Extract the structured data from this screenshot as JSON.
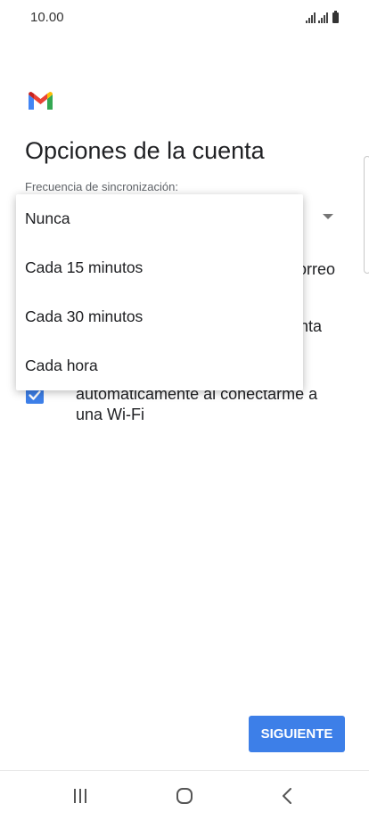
{
  "status_bar": {
    "time": "10.00"
  },
  "page": {
    "title": "Opciones de la cuenta",
    "sync_label": "Frecuencia de sincronización:",
    "background_fragments": [
      "orreo",
      "nta"
    ],
    "wifi_checkbox": {
      "checked": true,
      "label_lines": [
        "automáticamente al conectarme a",
        "una Wi-Fi"
      ]
    }
  },
  "dropdown": {
    "options": [
      "Nunca",
      "Cada 15 minutos",
      "Cada 30 minutos",
      "Cada hora"
    ]
  },
  "actions": {
    "next_label": "SIGUIENTE"
  },
  "colors": {
    "accent": "#3d7fe8",
    "text_primary": "#202124",
    "text_secondary": "#5f6368"
  },
  "icons": {
    "status": [
      "signal-icon",
      "signal-icon",
      "battery-icon"
    ],
    "nav": [
      "recent-apps-icon",
      "home-icon",
      "back-icon"
    ],
    "logo": "gmail-logo"
  }
}
